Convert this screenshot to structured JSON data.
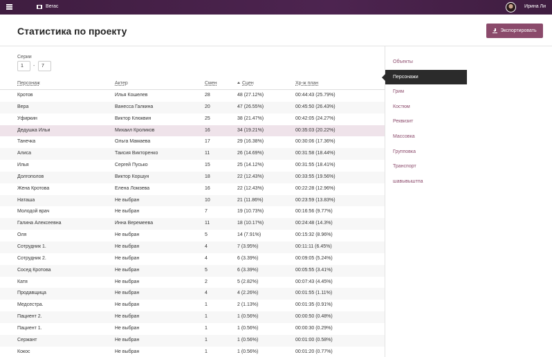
{
  "topbar": {
    "project_name": "Вегас",
    "user_name": "Ирина Ли"
  },
  "header": {
    "title": "Статистика по проекту",
    "export_label": "Экспортировать"
  },
  "filters": {
    "series_label": "Серии",
    "series_from": "1",
    "series_separator": "-",
    "series_to": "7"
  },
  "table": {
    "columns": [
      "Персонаж",
      "Актер",
      "Смен",
      "Сцен",
      "Хр-ж план"
    ],
    "sorted_column": "Сцен",
    "rows": [
      {
        "character": "Кротов",
        "actor": "Илья Кошелев",
        "shifts": "28",
        "scenes": "48 (27.12%)",
        "timing": "00:44:43 (25.79%)"
      },
      {
        "character": "Вера",
        "actor": "Ванесса Галкина",
        "shifts": "20",
        "scenes": "47 (26.55%)",
        "timing": "00:45:50 (26.43%)"
      },
      {
        "character": "Уфиркин",
        "actor": "Виктор Клюквин",
        "shifts": "25",
        "scenes": "38 (21.47%)",
        "timing": "00:42:05 (24.27%)"
      },
      {
        "character": "Дедушка Ильи",
        "actor": "Михаил Кроликов",
        "shifts": "16",
        "scenes": "34 (19.21%)",
        "timing": "00:35:03 (20.22%)"
      },
      {
        "character": "Танечка",
        "actor": "Ольга Мамаева",
        "shifts": "17",
        "scenes": "29 (16.38%)",
        "timing": "00:30:06 (17.36%)"
      },
      {
        "character": "Алиса",
        "actor": "Таисия Викторенко",
        "shifts": "11",
        "scenes": "26 (14.69%)",
        "timing": "00:31:58 (18.44%)"
      },
      {
        "character": "Илья",
        "actor": "Сергей Пусько",
        "shifts": "15",
        "scenes": "25 (14.12%)",
        "timing": "00:31:55 (18.41%)"
      },
      {
        "character": "Долгополов",
        "actor": "Виктор Коршун",
        "shifts": "18",
        "scenes": "22 (12.43%)",
        "timing": "00:33:55 (19.56%)"
      },
      {
        "character": "Жена Кротова",
        "actor": "Елена Ломзева",
        "shifts": "16",
        "scenes": "22 (12.43%)",
        "timing": "00:22:28 (12.96%)"
      },
      {
        "character": "Наташа",
        "actor": "Не выбран",
        "shifts": "10",
        "scenes": "21 (11.86%)",
        "timing": "00:23:59 (13.83%)"
      },
      {
        "character": "Молодой врач",
        "actor": "Не выбран",
        "shifts": "7",
        "scenes": "19 (10.73%)",
        "timing": "00:16:56 (9.77%)"
      },
      {
        "character": "Галина Алексеевна",
        "actor": "Инна Веремеева",
        "shifts": "11",
        "scenes": "18 (10.17%)",
        "timing": "00:24:48 (14.3%)"
      },
      {
        "character": "Оля",
        "actor": "Не выбран",
        "shifts": "5",
        "scenes": "14 (7.91%)",
        "timing": "00:15:32 (8.96%)"
      },
      {
        "character": "Сотрудник 1.",
        "actor": "Не выбран",
        "shifts": "4",
        "scenes": "7 (3.95%)",
        "timing": "00:11:11 (6.45%)"
      },
      {
        "character": "Сотрудник 2.",
        "actor": "Не выбран",
        "shifts": "4",
        "scenes": "6 (3.39%)",
        "timing": "00:09:05 (5.24%)"
      },
      {
        "character": "Сосед Кротова",
        "actor": "Не выбран",
        "shifts": "5",
        "scenes": "6 (3.39%)",
        "timing": "00:05:55 (3.41%)"
      },
      {
        "character": "Катя",
        "actor": "Не выбран",
        "shifts": "2",
        "scenes": "5 (2.82%)",
        "timing": "00:07:43 (4.45%)"
      },
      {
        "character": "Продавщица",
        "actor": "Не выбран",
        "shifts": "4",
        "scenes": "4 (2.26%)",
        "timing": "00:01:55 (1.11%)"
      },
      {
        "character": "Медсестра.",
        "actor": "Не выбран",
        "shifts": "1",
        "scenes": "2 (1.13%)",
        "timing": "00:01:35 (0.91%)"
      },
      {
        "character": "Пациент 2.",
        "actor": "Не выбран",
        "shifts": "1",
        "scenes": "1 (0.56%)",
        "timing": "00:00:50 (0.48%)"
      },
      {
        "character": "Пациент 1.",
        "actor": "Не выбран",
        "shifts": "1",
        "scenes": "1 (0.56%)",
        "timing": "00:00:30 (0.29%)"
      },
      {
        "character": "Сержант",
        "actor": "Не выбран",
        "shifts": "1",
        "scenes": "1 (0.56%)",
        "timing": "00:01:00 (0.58%)"
      },
      {
        "character": "Кокос",
        "actor": "Не выбран",
        "shifts": "1",
        "scenes": "1 (0.56%)",
        "timing": "00:01:20 (0.77%)"
      }
    ],
    "highlighted_row": "Дедушка Ильи"
  },
  "sidebar": {
    "items": [
      "Объекты",
      "Персонажи",
      "Грим",
      "Костюм",
      "Реквизит",
      "Массовка",
      "Групповка",
      "Транспорт",
      "шавывыштпа"
    ],
    "active_item": "Персонажи"
  },
  "colors": {
    "topbar": "#4d2450",
    "accent": "#8b4a6b",
    "active_nav": "#2b2b2b",
    "highlight_row": "#efe3ea"
  },
  "icons": [
    "menu-icon",
    "film-icon",
    "download-icon",
    "sort-up-icon"
  ]
}
